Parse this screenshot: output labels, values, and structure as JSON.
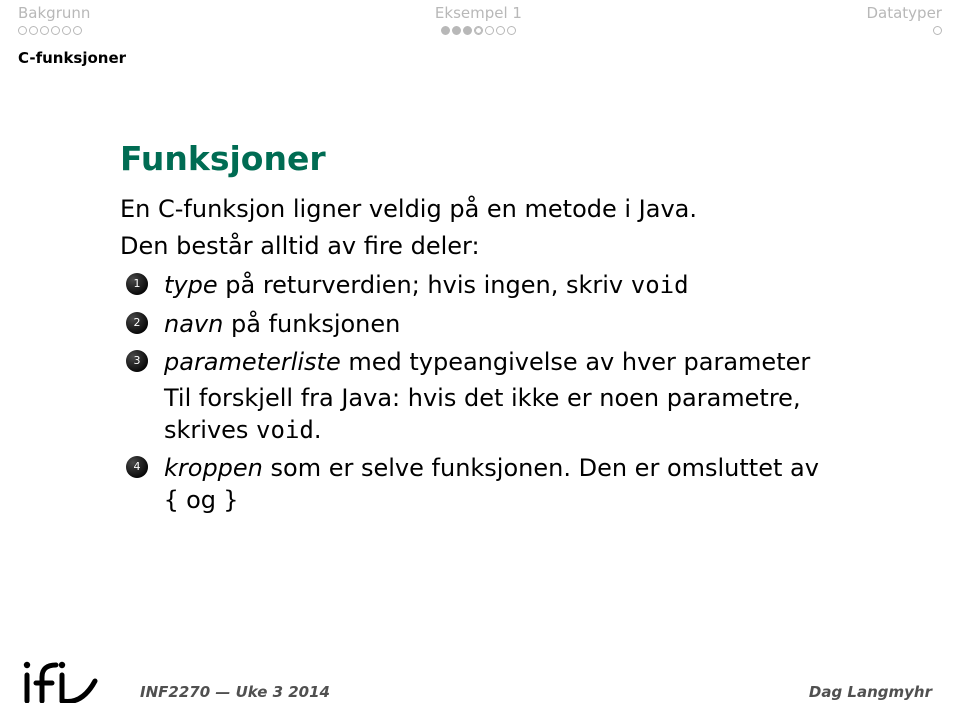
{
  "nav": {
    "left": {
      "label": "Bakgrunn",
      "dots": 6,
      "fill": 0,
      "current": -1
    },
    "center": {
      "label": "Eksempel 1",
      "dots": 7,
      "fill": 3,
      "current": 3
    },
    "right": {
      "label": "Datatyper",
      "dots": 1,
      "fill": 0,
      "current": -1
    }
  },
  "subsection": "C-funksjoner",
  "title": "Funksjoner",
  "intro_1": "En C-funksjon ligner veldig på en metode i Java.",
  "intro_2": "Den består alltid av fire deler:",
  "items": [
    {
      "n": "1",
      "pre": "type",
      "mid": " på returverdien; hvis ingen, skriv ",
      "tt": "void"
    },
    {
      "n": "2",
      "pre": "navn",
      "mid": " på funksjonen"
    },
    {
      "n": "3",
      "pre": "parameterliste",
      "mid": " med typeangivelse av hver parameter",
      "sub_a": "Til forskjell fra Java: hvis det ikke er noen parametre, skrives ",
      "sub_tt": "void",
      "sub_b": "."
    },
    {
      "n": "4",
      "pre": "kroppen",
      "mid": " som er selve funksjonen. Den er omsluttet av ",
      "tt1": "{",
      "mid2": " og ",
      "tt2": "}"
    }
  ],
  "footer": {
    "title": "INF2270 — Uke 3 2014",
    "author": "Dag Langmyhr"
  }
}
